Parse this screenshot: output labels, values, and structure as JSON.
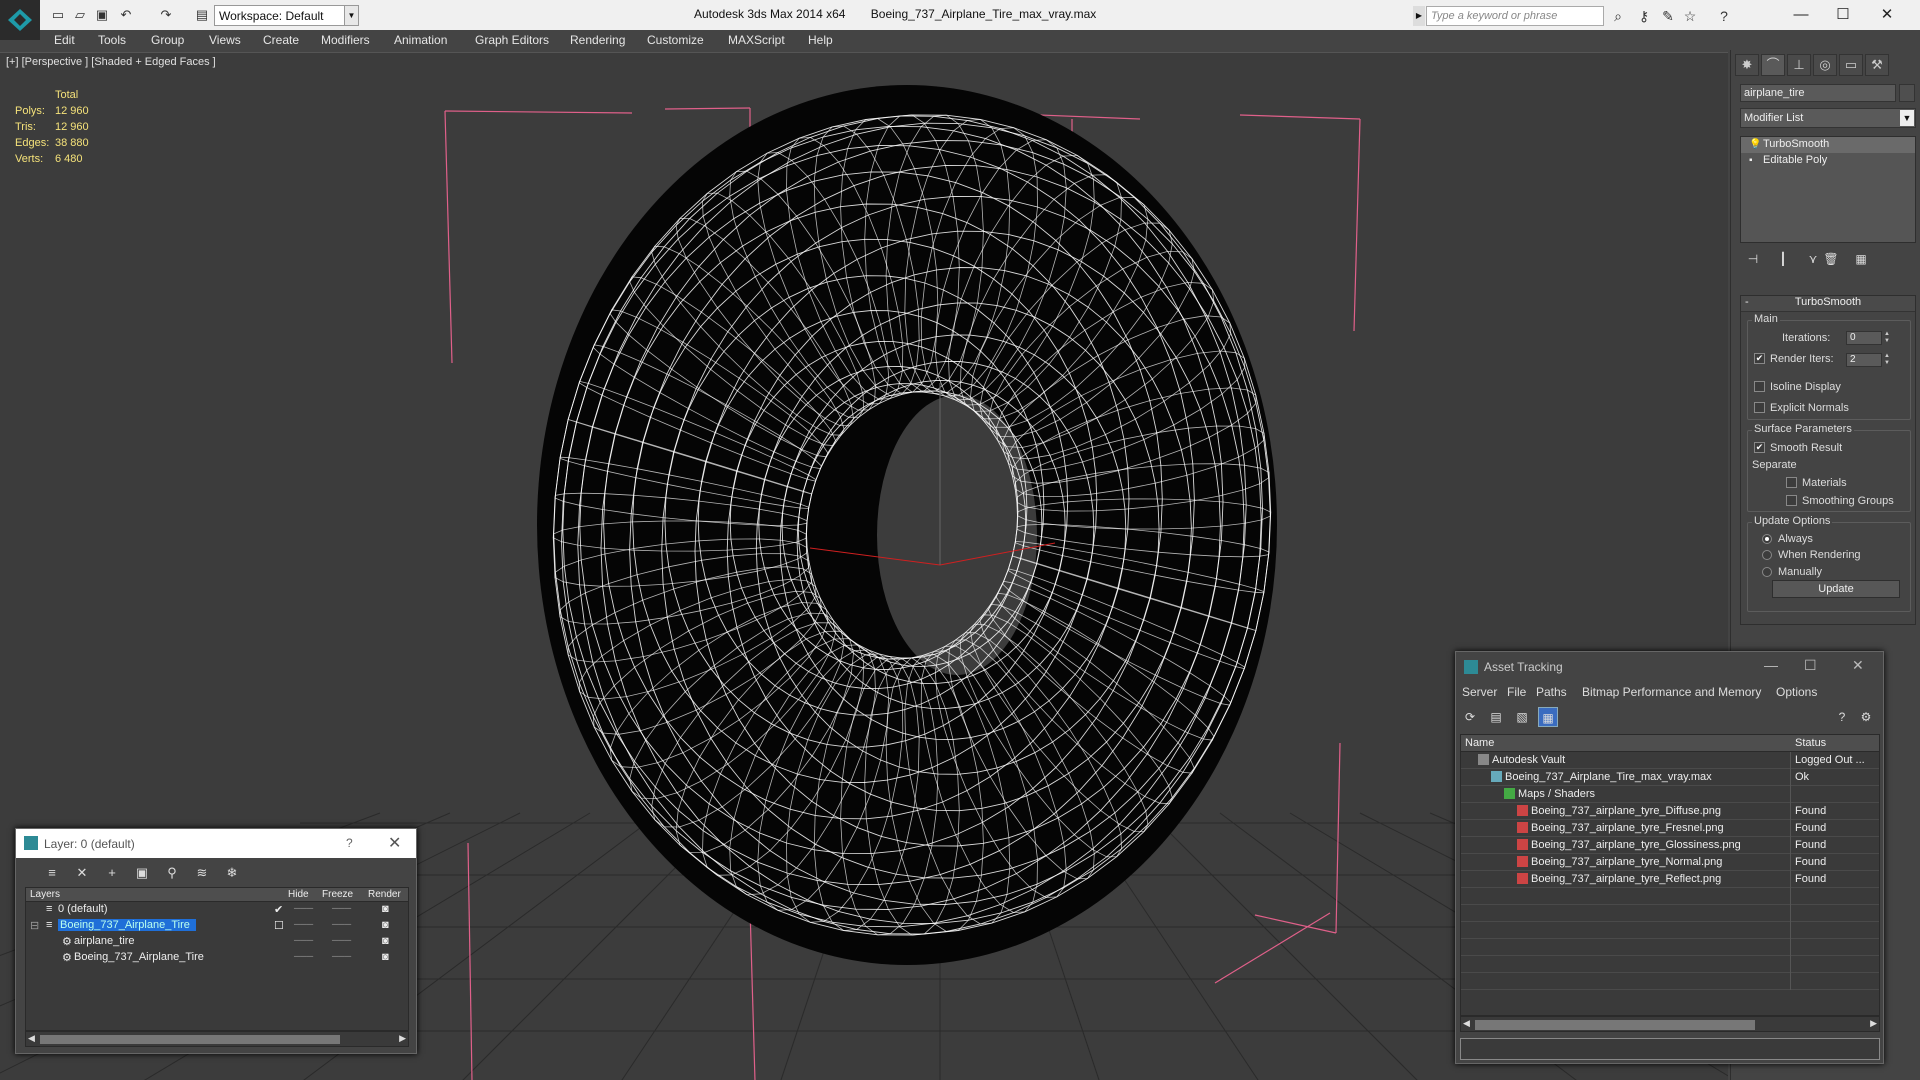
{
  "titlebar": {
    "workspace": "Workspace: Default",
    "app_name": "Autodesk 3ds Max  2014 x64",
    "file_name": "Boeing_737_Airplane_Tire_max_vray.max",
    "search_placeholder": "Type a keyword or phrase"
  },
  "menu": [
    "Edit",
    "Tools",
    "Group",
    "Views",
    "Create",
    "Modifiers",
    "Animation",
    "Graph Editors",
    "Rendering",
    "Customize",
    "MAXScript",
    "Help"
  ],
  "viewport": {
    "label": "[+] [Perspective ] [Shaded + Edged Faces ]",
    "stats": {
      "total_label": "Total",
      "rows": [
        {
          "k": "Polys:",
          "v": "12 960"
        },
        {
          "k": "Tris:",
          "v": "12 960"
        },
        {
          "k": "Edges:",
          "v": "38 880"
        },
        {
          "k": "Verts:",
          "v": "6 480"
        }
      ]
    }
  },
  "command_panel": {
    "object_name": "airplane_tire",
    "modifier_list": "Modifier List",
    "stack": [
      "TurboSmooth",
      "Editable Poly"
    ],
    "turbosmooth": {
      "title": "TurboSmooth",
      "main": "Main",
      "iterations_label": "Iterations:",
      "iterations_value": "0",
      "render_iters_label": "Render Iters:",
      "render_iters_value": "2",
      "isoline": "Isoline Display",
      "explicit_normals": "Explicit Normals",
      "surface_params": "Surface Parameters",
      "smooth_result": "Smooth Result",
      "separate": "Separate",
      "materials": "Materials",
      "smoothing_groups": "Smoothing Groups",
      "update_options": "Update Options",
      "always": "Always",
      "when_rendering": "When Rendering",
      "manually": "Manually",
      "update_button": "Update"
    }
  },
  "layer_dialog": {
    "title": "Layer: 0 (default)",
    "help": "?",
    "columns": {
      "layers": "Layers",
      "hide": "Hide",
      "freeze": "Freeze",
      "render": "Render"
    },
    "rows": [
      {
        "name": "0 (default)",
        "indent": 1,
        "selected": false
      },
      {
        "name": "Boeing_737_Airplane_Tire",
        "indent": 1,
        "selected": true
      },
      {
        "name": "airplane_tire",
        "indent": 2,
        "selected": false
      },
      {
        "name": "Boeing_737_Airplane_Tire",
        "indent": 2,
        "selected": false
      }
    ]
  },
  "asset_tracking": {
    "title": "Asset Tracking",
    "menu": [
      "Server",
      "File",
      "Paths",
      "Bitmap Performance and Memory",
      "Options"
    ],
    "columns": {
      "name": "Name",
      "status": "Status"
    },
    "rows": [
      {
        "name": "Autodesk Vault",
        "status": "Logged Out ...",
        "indent": 1,
        "icon": "vault"
      },
      {
        "name": "Boeing_737_Airplane_Tire_max_vray.max",
        "status": "Ok",
        "indent": 2,
        "icon": "max"
      },
      {
        "name": "Maps / Shaders",
        "status": "",
        "indent": 3,
        "icon": "maps"
      },
      {
        "name": "Boeing_737_airplane_tyre_Diffuse.png",
        "status": "Found",
        "indent": 4,
        "icon": "png"
      },
      {
        "name": "Boeing_737_airplane_tyre_Fresnel.png",
        "status": "Found",
        "indent": 4,
        "icon": "png"
      },
      {
        "name": "Boeing_737_airplane_tyre_Glossiness.png",
        "status": "Found",
        "indent": 4,
        "icon": "png"
      },
      {
        "name": "Boeing_737_airplane_tyre_Normal.png",
        "status": "Found",
        "indent": 4,
        "icon": "png"
      },
      {
        "name": "Boeing_737_airplane_tyre_Reflect.png",
        "status": "Found",
        "indent": 4,
        "icon": "png"
      }
    ]
  },
  "colors": {
    "stats_text": "#f5e27a",
    "selection": "#1f6fd8",
    "wire": "#ffffff",
    "bbox": "#e0608a"
  }
}
